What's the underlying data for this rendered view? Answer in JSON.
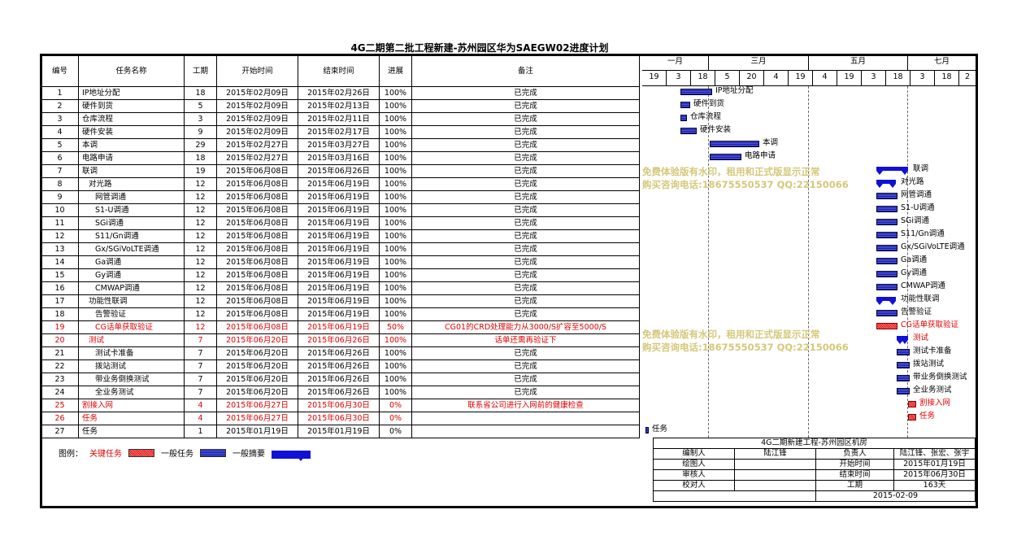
{
  "title": "4G二期第二批工程新建-苏州园区华为SAEGW02进度计划",
  "columns": [
    "编号",
    "任务名称",
    "工期",
    "开始时间",
    "结束时间",
    "进展",
    "备注"
  ],
  "timeline": {
    "months": [
      "一月",
      "三月",
      "五月",
      "七月"
    ],
    "days": [
      "19",
      "3",
      "18",
      "5",
      "20",
      "4",
      "19",
      "4",
      "19",
      "3",
      "18",
      "3",
      "18",
      "2"
    ]
  },
  "tasks": [
    {
      "id": "1",
      "name": "IP地址分配",
      "dur": "18",
      "start": "2015年02月09日",
      "end": "2015年02月26日",
      "progress": "100%",
      "note": "已完成",
      "critical": false,
      "indent": 0
    },
    {
      "id": "2",
      "name": "硬件到货",
      "dur": "5",
      "start": "2015年02月09日",
      "end": "2015年02月13日",
      "progress": "100%",
      "note": "已完成",
      "critical": false,
      "indent": 0
    },
    {
      "id": "3",
      "name": "仓库流程",
      "dur": "3",
      "start": "2015年02月09日",
      "end": "2015年02月11日",
      "progress": "100%",
      "note": "已完成",
      "critical": false,
      "indent": 0
    },
    {
      "id": "4",
      "name": "硬件安装",
      "dur": "9",
      "start": "2015年02月09日",
      "end": "2015年02月17日",
      "progress": "100%",
      "note": "已完成",
      "critical": false,
      "indent": 0
    },
    {
      "id": "5",
      "name": "本调",
      "dur": "29",
      "start": "2015年02月27日",
      "end": "2015年03月27日",
      "progress": "100%",
      "note": "已完成",
      "critical": false,
      "indent": 0
    },
    {
      "id": "6",
      "name": "电路申请",
      "dur": "18",
      "start": "2015年02月27日",
      "end": "2015年03月16日",
      "progress": "100%",
      "note": "已完成",
      "critical": false,
      "indent": 0
    },
    {
      "id": "7",
      "name": "联调",
      "dur": "19",
      "start": "2015年06月08日",
      "end": "2015年06月26日",
      "progress": "100%",
      "note": "已完成",
      "critical": false,
      "indent": 0
    },
    {
      "id": "8",
      "name": "对光路",
      "dur": "12",
      "start": "2015年06月08日",
      "end": "2015年06月19日",
      "progress": "100%",
      "note": "已完成",
      "critical": false,
      "indent": 1
    },
    {
      "id": "9",
      "name": "网管调通",
      "dur": "12",
      "start": "2015年06月08日",
      "end": "2015年06月19日",
      "progress": "100%",
      "note": "已完成",
      "critical": false,
      "indent": 2
    },
    {
      "id": "10",
      "name": "S1-U调通",
      "dur": "12",
      "start": "2015年06月08日",
      "end": "2015年06月19日",
      "progress": "100%",
      "note": "已完成",
      "critical": false,
      "indent": 2
    },
    {
      "id": "11",
      "name": "SGi调通",
      "dur": "12",
      "start": "2015年06月08日",
      "end": "2015年06月19日",
      "progress": "100%",
      "note": "已完成",
      "critical": false,
      "indent": 2
    },
    {
      "id": "12",
      "name": "S11/Gn调通",
      "dur": "12",
      "start": "2015年06月08日",
      "end": "2015年06月19日",
      "progress": "100%",
      "note": "已完成",
      "critical": false,
      "indent": 2
    },
    {
      "id": "13",
      "name": "Gx/SGiVoLTE调通",
      "dur": "12",
      "start": "2015年06月08日",
      "end": "2015年06月19日",
      "progress": "100%",
      "note": "已完成",
      "critical": false,
      "indent": 2
    },
    {
      "id": "14",
      "name": "Ga调通",
      "dur": "12",
      "start": "2015年06月08日",
      "end": "2015年06月19日",
      "progress": "100%",
      "note": "已完成",
      "critical": false,
      "indent": 2
    },
    {
      "id": "15",
      "name": "Gy调通",
      "dur": "12",
      "start": "2015年06月08日",
      "end": "2015年06月19日",
      "progress": "100%",
      "note": "已完成",
      "critical": false,
      "indent": 2
    },
    {
      "id": "16",
      "name": "CMWAP调通",
      "dur": "12",
      "start": "2015年06月08日",
      "end": "2015年06月19日",
      "progress": "100%",
      "note": "已完成",
      "critical": false,
      "indent": 2
    },
    {
      "id": "17",
      "name": "功能性联调",
      "dur": "12",
      "start": "2015年06月08日",
      "end": "2015年06月19日",
      "progress": "100%",
      "note": "已完成",
      "critical": false,
      "indent": 1
    },
    {
      "id": "18",
      "name": "告警验证",
      "dur": "12",
      "start": "2015年06月08日",
      "end": "2015年06月19日",
      "progress": "100%",
      "note": "已完成",
      "critical": false,
      "indent": 2
    },
    {
      "id": "19",
      "name": "CG话单获取验证",
      "dur": "12",
      "start": "2015年06月08日",
      "end": "2015年06月19日",
      "progress": "50%",
      "note": "CG01的CRD处理能力从3000/S扩容至5000/S",
      "critical": true,
      "indent": 2
    },
    {
      "id": "20",
      "name": "测试",
      "dur": "7",
      "start": "2015年06月20日",
      "end": "2015年06月26日",
      "progress": "100%",
      "note": "话单还需再验证下",
      "critical": true,
      "indent": 1
    },
    {
      "id": "21",
      "name": "测试卡准备",
      "dur": "7",
      "start": "2015年06月20日",
      "end": "2015年06月26日",
      "progress": "100%",
      "note": "已完成",
      "critical": false,
      "indent": 2
    },
    {
      "id": "22",
      "name": "拨站测试",
      "dur": "7",
      "start": "2015年06月20日",
      "end": "2015年06月26日",
      "progress": "100%",
      "note": "已完成",
      "critical": false,
      "indent": 2
    },
    {
      "id": "23",
      "name": "带业务倒换测试",
      "dur": "7",
      "start": "2015年06月20日",
      "end": "2015年06月26日",
      "progress": "100%",
      "note": "已完成",
      "critical": false,
      "indent": 2
    },
    {
      "id": "24",
      "name": "全业务测试",
      "dur": "7",
      "start": "2015年06月20日",
      "end": "2015年06月26日",
      "progress": "100%",
      "note": "已完成",
      "critical": false,
      "indent": 2
    },
    {
      "id": "25",
      "name": "割接入网",
      "dur": "4",
      "start": "2015年06月27日",
      "end": "2015年06月30日",
      "progress": "0%",
      "note": "联系省公司进行入网前的健康检查",
      "critical": true,
      "indent": 0
    },
    {
      "id": "26",
      "name": "任务",
      "dur": "4",
      "start": "2015年06月27日",
      "end": "2015年06月30日",
      "progress": "0%",
      "note": "",
      "critical": true,
      "indent": 0
    },
    {
      "id": "27",
      "name": "任务",
      "dur": "1",
      "start": "2015年01月19日",
      "end": "2015年01月19日",
      "progress": "0%",
      "note": "",
      "critical": false,
      "indent": 0
    }
  ],
  "watermark": {
    "line1": "免费体验版有水印，租用和正式版显示正常",
    "line2": "购买咨询电话:18675550537 QQ:22150066"
  },
  "legend": {
    "label": "图例：",
    "critical": "关键任务",
    "normal": "一般任务",
    "summary": "一般摘要"
  },
  "info": {
    "project": "4G二期新建工程-苏州园区机房",
    "editor_label": "编制人",
    "editor": "陆江锋",
    "owner_label": "负责人",
    "owner": "陆江锋、张宏、张宇",
    "drawer_label": "绘图人",
    "start_label": "开始时间",
    "start": "2015年01月19日",
    "reviewer_label": "审核人",
    "end_label": "结束时间",
    "end": "2015年06月30日",
    "checker_label": "校对人",
    "dur_label": "工期",
    "dur": "163天",
    "date": "2015-02-09"
  },
  "colors": {
    "critical": "#e00000",
    "normal_bar": "#2a2ab8",
    "summary_bar": "#1010d8",
    "watermark": "#d4c87a"
  }
}
